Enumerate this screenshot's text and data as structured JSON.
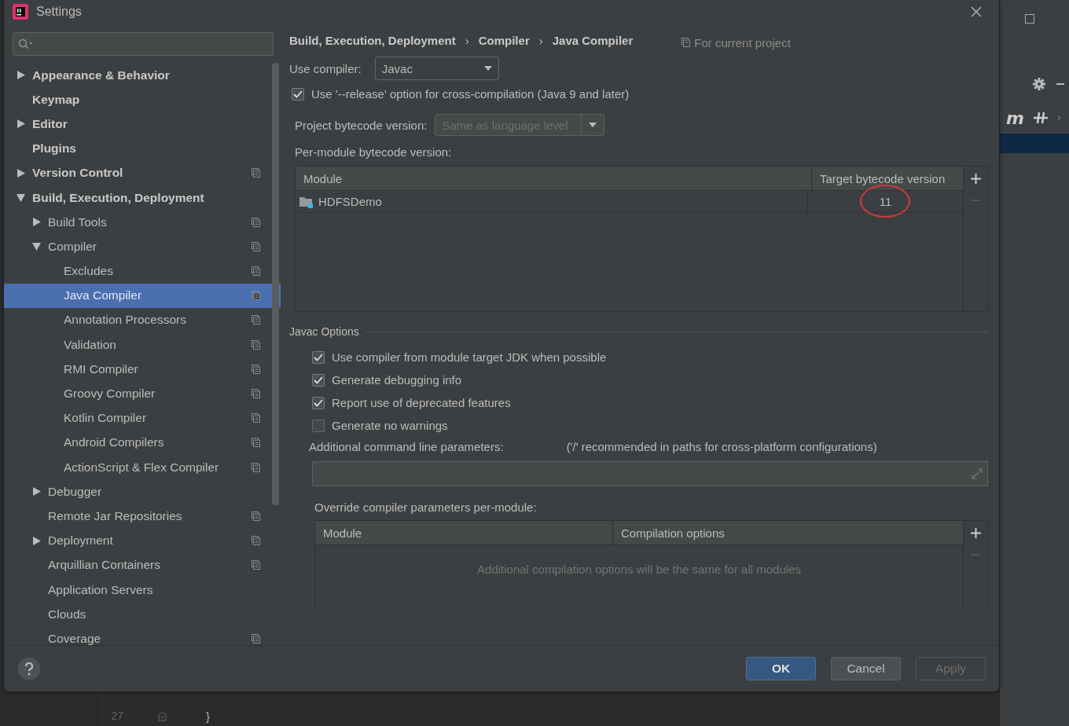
{
  "window": {
    "title": "Settings"
  },
  "sidebar": {
    "items": [
      {
        "label": "Appearance & Behavior",
        "bold": true,
        "expanded": false,
        "project_level": false,
        "selected": false
      },
      {
        "label": "Keymap",
        "bold": true,
        "project_level": false,
        "selected": false
      },
      {
        "label": "Editor",
        "bold": true,
        "expanded": false,
        "project_level": false,
        "selected": false
      },
      {
        "label": "Plugins",
        "bold": true,
        "project_level": false,
        "selected": false
      },
      {
        "label": "Version Control",
        "bold": true,
        "expanded": false,
        "project_level": true,
        "selected": false
      },
      {
        "label": "Build, Execution, Deployment",
        "bold": true,
        "expanded": true,
        "project_level": false,
        "selected": false,
        "children": [
          {
            "label": "Build Tools",
            "bold": false,
            "expanded": false,
            "project_level": true,
            "selected": false
          },
          {
            "label": "Compiler",
            "bold": false,
            "expanded": true,
            "project_level": true,
            "selected": false,
            "children": [
              {
                "label": "Excludes",
                "bold": false,
                "project_level": true,
                "selected": false
              },
              {
                "label": "Java Compiler",
                "bold": false,
                "project_level": true,
                "selected": true
              },
              {
                "label": "Annotation Processors",
                "bold": false,
                "project_level": true,
                "selected": false
              },
              {
                "label": "Validation",
                "bold": false,
                "project_level": true,
                "selected": false
              },
              {
                "label": "RMI Compiler",
                "bold": false,
                "project_level": true,
                "selected": false
              },
              {
                "label": "Groovy Compiler",
                "bold": false,
                "project_level": true,
                "selected": false
              },
              {
                "label": "Kotlin Compiler",
                "bold": false,
                "project_level": true,
                "selected": false
              },
              {
                "label": "Android Compilers",
                "bold": false,
                "project_level": true,
                "selected": false
              },
              {
                "label": "ActionScript & Flex Compiler",
                "bold": false,
                "project_level": true,
                "selected": false
              }
            ]
          },
          {
            "label": "Debugger",
            "bold": false,
            "expanded": false,
            "project_level": false,
            "selected": false
          },
          {
            "label": "Remote Jar Repositories",
            "bold": false,
            "project_level": true,
            "selected": false
          },
          {
            "label": "Deployment",
            "bold": false,
            "expanded": false,
            "project_level": true,
            "selected": false
          },
          {
            "label": "Arquillian Containers",
            "bold": false,
            "project_level": true,
            "selected": false
          },
          {
            "label": "Application Servers",
            "bold": false,
            "project_level": false,
            "selected": false
          },
          {
            "label": "Clouds",
            "bold": false,
            "project_level": false,
            "selected": false
          },
          {
            "label": "Coverage",
            "bold": false,
            "project_level": true,
            "selected": false
          }
        ]
      }
    ]
  },
  "breadcrumb": {
    "separator": "›",
    "items": [
      "Build, Execution, Deployment",
      "Compiler",
      "Java Compiler"
    ]
  },
  "scope_note": "For current project",
  "use_compiler": {
    "label": "Use compiler:",
    "value": "Javac"
  },
  "release_option": {
    "label": "Use '--release' option for cross-compilation (Java 9 and later)",
    "checked": true
  },
  "project_bytecode": {
    "label": "Project bytecode version:",
    "value": "Same as language level",
    "disabled": true
  },
  "per_module": {
    "label": "Per-module bytecode version:",
    "columns": [
      "Module",
      "Target bytecode version"
    ],
    "rows": [
      {
        "module": "HDFSDemo",
        "target": "11",
        "circled": true
      }
    ]
  },
  "javac_options": {
    "title": "Javac Options",
    "options": [
      {
        "label": "Use compiler from module target JDK when possible",
        "checked": true
      },
      {
        "label": "Generate debugging info",
        "checked": true
      },
      {
        "label": "Report use of deprecated features",
        "checked": true
      },
      {
        "label": "Generate no warnings",
        "checked": false
      }
    ],
    "params_label": "Additional command line parameters:",
    "params_hint": "('/' recommended in paths for cross-platform configurations)"
  },
  "override": {
    "label": "Override compiler parameters per-module:",
    "columns": [
      "Module",
      "Compilation options"
    ],
    "empty_text": "Additional compilation options will be the same for all modules"
  },
  "buttons": [
    {
      "label": "OK",
      "kind": "default"
    },
    {
      "label": "Cancel",
      "kind": "normal"
    },
    {
      "label": "Apply",
      "kind": "disabled"
    }
  ],
  "ide": {
    "toolbar_text": "m",
    "editor_lines": [
      {
        "number": "27",
        "code": "}"
      }
    ]
  }
}
